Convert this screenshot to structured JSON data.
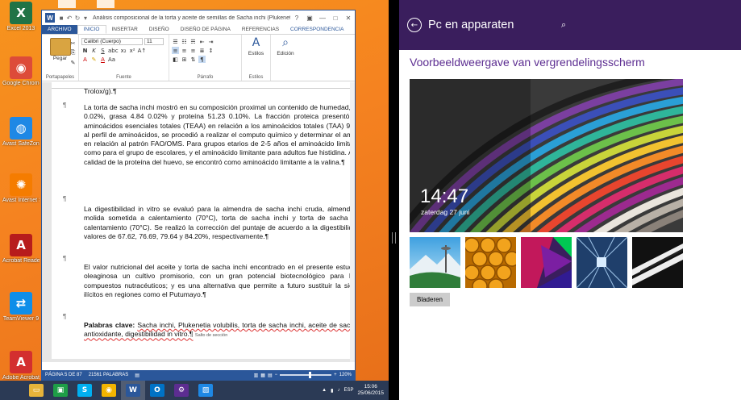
{
  "desktop": {
    "icons": [
      {
        "label": "Excel 2013",
        "icon": "excel-icon",
        "glyph": "X",
        "color": "#217346"
      },
      {
        "label": "Google Chrome",
        "icon": "chrome-icon",
        "glyph": "◉",
        "color": "#dd4b39"
      },
      {
        "label": "Avast SafeZone",
        "icon": "avast-safezone-icon",
        "glyph": "◍",
        "color": "#1e88e5"
      },
      {
        "label": "Avast Internet Security",
        "icon": "avast-icon",
        "glyph": "✺",
        "color": "#f57c00"
      },
      {
        "label": "Acrobat Reader DC",
        "icon": "acrobat-reader-icon",
        "glyph": "A",
        "color": "#b71c1c"
      },
      {
        "label": "TeamViewer 9",
        "icon": "teamviewer-icon",
        "glyph": "⇄",
        "color": "#0e8ee9"
      },
      {
        "label": "Adobe Acrobat",
        "icon": "adobe-acrobat-icon",
        "glyph": "A",
        "color": "#d32f2f"
      }
    ]
  },
  "word": {
    "title": "Análisis composicional de la torta y aceite de semillas de Sacha inchi (Plukenetia volubilis) - Word",
    "help_label": "?",
    "tabs": [
      "ARCHIVO",
      "INICIO",
      "INSERTAR",
      "DISEÑO",
      "DISEÑO DE PÁGINA",
      "REFERENCIAS",
      "CORRESPONDENCIA",
      "RE"
    ],
    "ribbon": {
      "paste_label": "Pegar",
      "font_name": "Calibri (Cuerpo)",
      "font_size": "11",
      "styles_label": "Estilos",
      "editing_label": "Edición",
      "groups": {
        "clipboard": "Portapapeles",
        "font": "Fuente",
        "paragraph": "Párrafo",
        "styles": "Estilos"
      }
    },
    "doc": {
      "frag_top": "Trolox/g).¶",
      "p1": "La torta de sacha inchi mostró en su composición proximal un contenido de humedad, ceniza bruta 4.79 0.02%, grasa 4.84 0.02% y proteína 51.23 0.10%. La fracción proteica presentó un contenido en aminoácidos esenciales totales (TEAA) en relación a los aminoácidos totales (TAA) 99.3%. De acuerdo al perfil de aminoácidos, se procedió a realizar el computo químico y determinar el aminoácido limitante en relación al patrón FAO/OMS. Para grupos etarios de 2-5 años el aminoácido limitante fue lisina, así como para el grupo de escolares, y el aminoácido limitante para adultos fue histidina. Al comparar con la calidad de la proteína del huevo, se encontró como aminoácido limitante a la valina.¶",
      "p2": "La digestibilidad in vitro se evaluó para la almendra de sacha inchi cruda, almendra de sacha inchi molida sometida a calentamiento (70°C), torta de sacha inchi y torta de sacha inchi sometida a calentamiento (70°C). Se realizó la corrección del puntaje de acuerdo a la digestibilidad, obteniéndose valores de 67.62, 76.69, 79.64 y 84.20%, respectivamente.¶",
      "p3": "El valor nutricional del aceite y torta de sacha inchi encontrado en el presente estudio hacen de esta oleaginosa un cultivo promisorio, con un gran potencial biotecnológico para la producción de compuestos nutracéuticos; y es una alternativa que permite a futuro sustituir la siembra de cultivos ilícitos en regiones como el Putumayo.¶",
      "kw_label": "Palabras clave:",
      "kw_text": "Sacha inchi, Plukenetia volubilis, torta de sacha inchi, aceite de sacha inchi, actividad antioxidante, digestibilidad in vitro.¶",
      "section_break": "Salto de sección"
    },
    "status": {
      "page": "PÁGINA 5 DE 87",
      "words": "21561 PALABRAS",
      "zoom": "120%"
    }
  },
  "settings": {
    "header_title": "Pc en apparaten",
    "heading": "Voorbeeldweergave van vergrendelingsscherm",
    "lock_time": "14:47",
    "lock_date": "zaterdag 27 juni",
    "browse_label": "Bladeren",
    "thumbnails": [
      "seattle-space-needle",
      "honeycomb",
      "colorful-geometric",
      "tunnel-perspective",
      "piano-keys"
    ]
  },
  "taskbar": {
    "items": [
      {
        "name": "file-explorer",
        "glyph": "▭",
        "color": "#e6b33a"
      },
      {
        "name": "store",
        "glyph": "▣",
        "color": "#1e9e47"
      },
      {
        "name": "skype",
        "glyph": "S",
        "color": "#00aff0"
      },
      {
        "name": "chrome",
        "glyph": "◉",
        "color": "#f2b400"
      },
      {
        "name": "word",
        "glyph": "W",
        "color": "#2b579a"
      },
      {
        "name": "outlook",
        "glyph": "O",
        "color": "#0072c6"
      },
      {
        "name": "settings",
        "glyph": "⚙",
        "color": "#5c2d91"
      },
      {
        "name": "photos",
        "glyph": "▨",
        "color": "#1e88e5"
      }
    ],
    "language": "ESP",
    "time": "15:06",
    "date": "25/06/2015"
  }
}
